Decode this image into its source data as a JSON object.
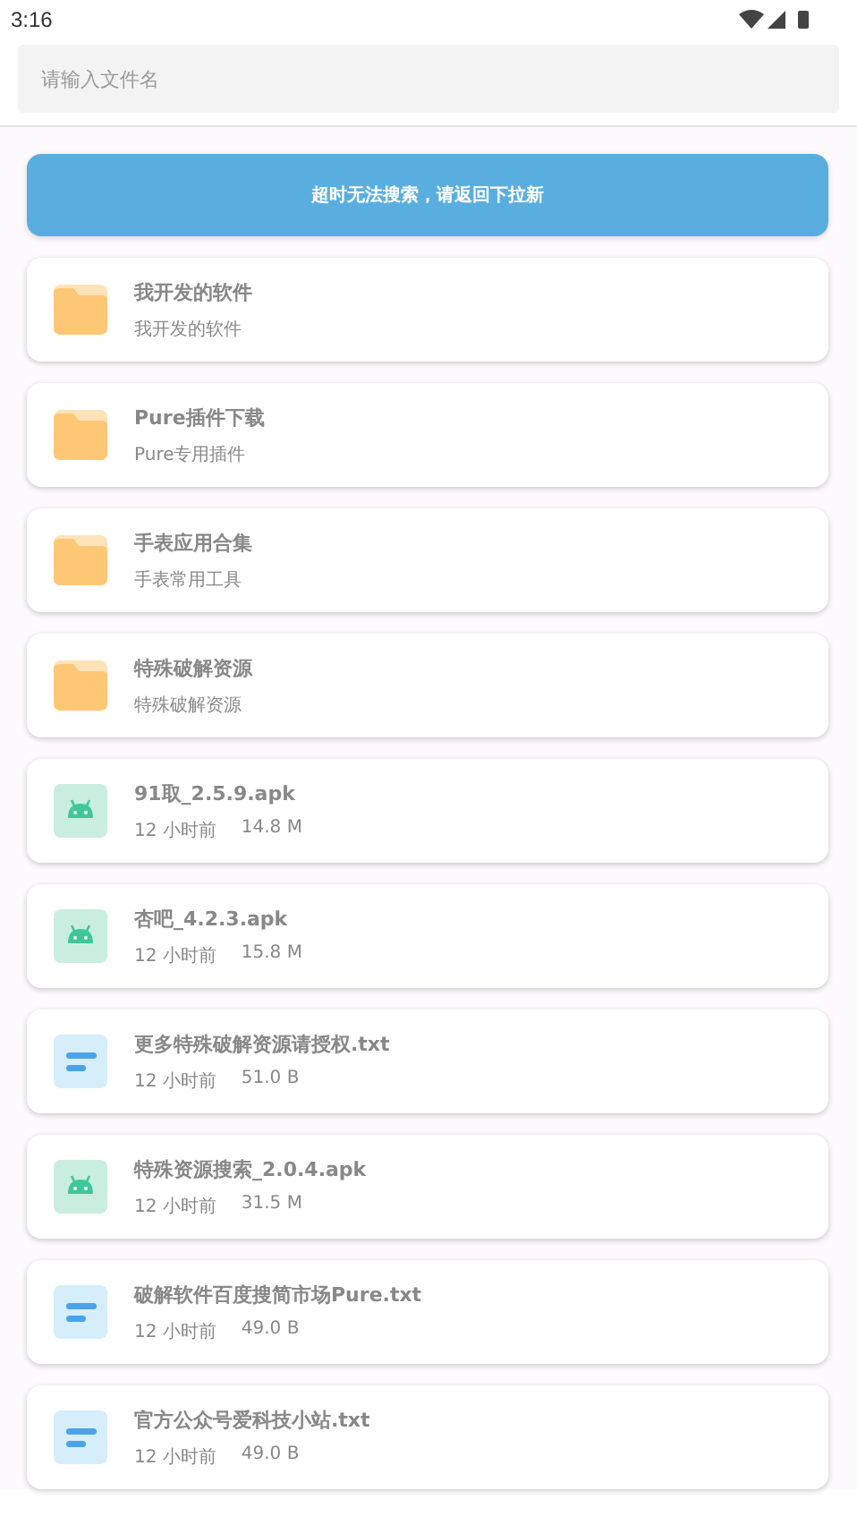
{
  "status_bar": {
    "time": "3:16"
  },
  "search": {
    "placeholder": "请输入文件名"
  },
  "notice": "超时无法搜索，请返回下拉新",
  "items": [
    {
      "kind": "folder",
      "title": "我开发的软件",
      "subtitle": "我开发的软件"
    },
    {
      "kind": "folder",
      "title": "Pure插件下载",
      "subtitle": "Pure专用插件"
    },
    {
      "kind": "folder",
      "title": "手表应用合集",
      "subtitle": "手表常用工具"
    },
    {
      "kind": "folder",
      "title": "特殊破解资源",
      "subtitle": "特殊破解资源"
    },
    {
      "kind": "apk",
      "title": "91取_2.5.9.apk",
      "time": "12 小时前",
      "size": "14.8 M"
    },
    {
      "kind": "apk",
      "title": "杏吧_4.2.3.apk",
      "time": "12 小时前",
      "size": "15.8 M"
    },
    {
      "kind": "txt",
      "title": "更多特殊破解资源请授权.txt",
      "time": "12 小时前",
      "size": "51.0 B"
    },
    {
      "kind": "apk",
      "title": "特殊资源搜索_2.0.4.apk",
      "time": "12 小时前",
      "size": "31.5 M"
    },
    {
      "kind": "txt",
      "title": "破解软件百度搜简市场Pure.txt",
      "time": "12 小时前",
      "size": "49.0 B"
    },
    {
      "kind": "txt",
      "title": "官方公众号爱科技小站.txt",
      "time": "12 小时前",
      "size": "49.0 B"
    }
  ]
}
